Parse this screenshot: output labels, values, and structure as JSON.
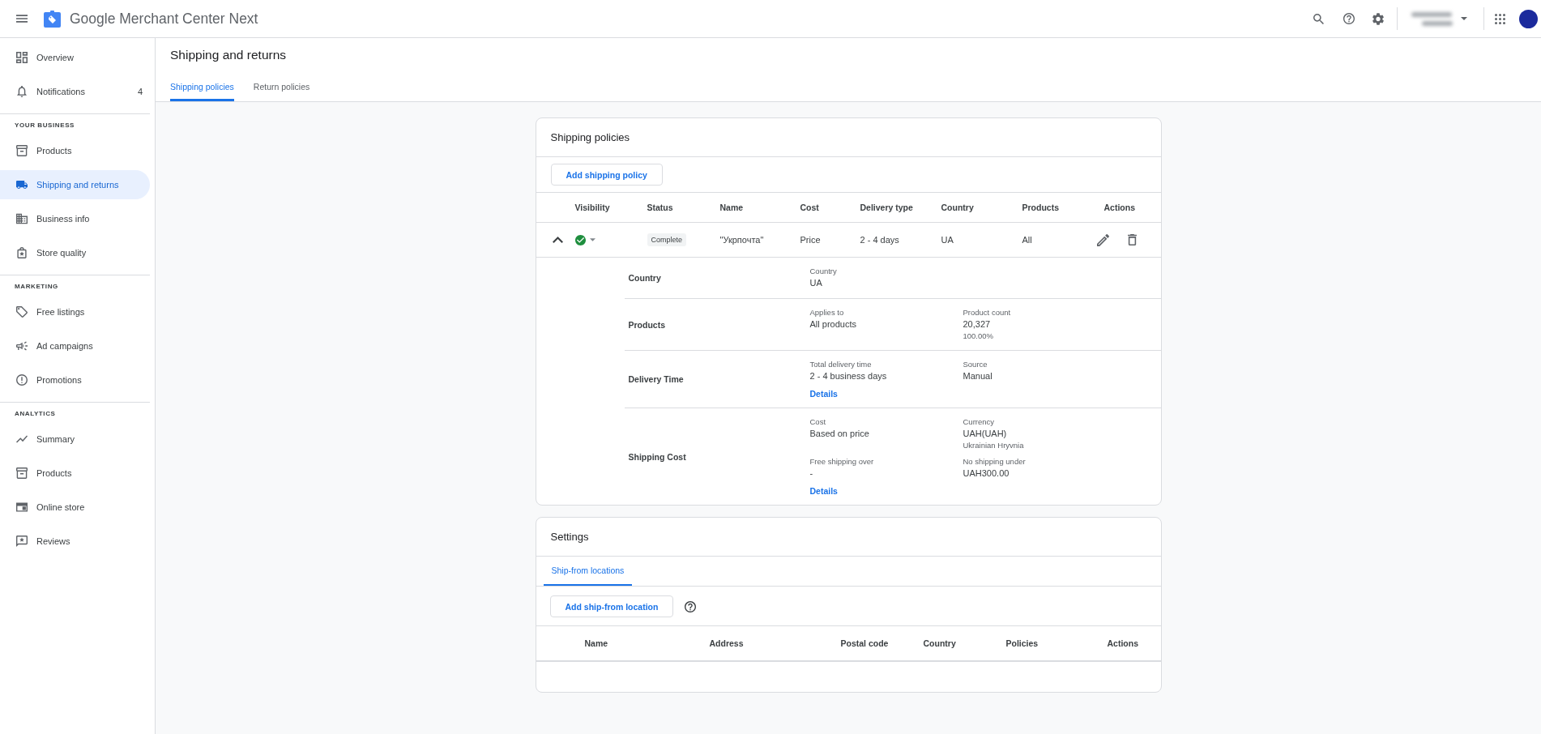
{
  "top_bar": {
    "title": "Google Merchant Center Next"
  },
  "sidebar": {
    "top_items": [
      {
        "label": "Overview",
        "selected": false
      },
      {
        "label": "Notifications",
        "selected": false,
        "count": "4"
      }
    ],
    "sections": [
      {
        "heading": "YOUR BUSINESS",
        "items": [
          {
            "label": "Products",
            "selected": false
          },
          {
            "label": "Shipping and returns",
            "selected": true
          },
          {
            "label": "Business info",
            "selected": false
          },
          {
            "label": "Store quality",
            "selected": false
          }
        ]
      },
      {
        "heading": "MARKETING",
        "items": [
          {
            "label": "Free listings",
            "selected": false
          },
          {
            "label": "Ad campaigns",
            "selected": false
          },
          {
            "label": "Promotions",
            "selected": false
          }
        ]
      },
      {
        "heading": "ANALYTICS",
        "items": [
          {
            "label": "Summary",
            "selected": false
          },
          {
            "label": "Products",
            "selected": false
          },
          {
            "label": "Online store",
            "selected": false
          },
          {
            "label": "Reviews",
            "selected": false
          }
        ]
      }
    ]
  },
  "page": {
    "title": "Shipping and returns",
    "tabs": [
      {
        "label": "Shipping policies",
        "selected": true
      },
      {
        "label": "Return policies",
        "selected": false
      }
    ]
  },
  "shipping_policies": {
    "title": "Shipping policies",
    "add_button": "Add shipping policy",
    "columns": [
      "Visibility",
      "Status",
      "Name",
      "Cost",
      "Delivery type",
      "Country",
      "Products",
      "Actions"
    ],
    "rows": [
      {
        "expanded": true,
        "status": "Complete",
        "name": "\"Укрпочта\"",
        "cost": "Price",
        "delivery_type": "2 - 4 days",
        "country": "UA",
        "products": "All",
        "details": [
          {
            "label": "Country",
            "columns": [
              {
                "fields": [
                  {
                    "label": "Country",
                    "value": "UA"
                  }
                ]
              }
            ]
          },
          {
            "label": "Products",
            "columns": [
              {
                "fields": [
                  {
                    "label": "Applies to",
                    "value": "All products"
                  }
                ]
              },
              {
                "fields": [
                  {
                    "label": "Product count",
                    "value": "20,327",
                    "note": "100.00%"
                  }
                ]
              }
            ]
          },
          {
            "label": "Delivery Time",
            "columns": [
              {
                "fields": [
                  {
                    "label": "Total delivery time",
                    "value": "2 - 4 business days"
                  }
                ],
                "link": "Details"
              },
              {
                "fields": [
                  {
                    "label": "Source",
                    "value": "Manual"
                  }
                ]
              }
            ]
          },
          {
            "label": "Shipping Cost",
            "columns": [
              {
                "fields": [
                  {
                    "label": "Cost",
                    "value": "Based on price"
                  },
                  {
                    "label": "Free shipping over",
                    "value": "-"
                  }
                ],
                "link": "Details"
              },
              {
                "fields": [
                  {
                    "label": "Currency",
                    "value": "UAH(UAH)",
                    "note": "Ukrainian Hryvnia"
                  },
                  {
                    "label": "No shipping under",
                    "value": "UAH300.00"
                  }
                ]
              }
            ]
          }
        ]
      }
    ]
  },
  "settings": {
    "title": "Settings",
    "tabs": [
      {
        "label": "Ship-from locations",
        "selected": true
      }
    ],
    "add_button": "Add ship-from location",
    "columns": [
      "Name",
      "Address",
      "Postal code",
      "Country",
      "Policies",
      "Actions"
    ]
  }
}
